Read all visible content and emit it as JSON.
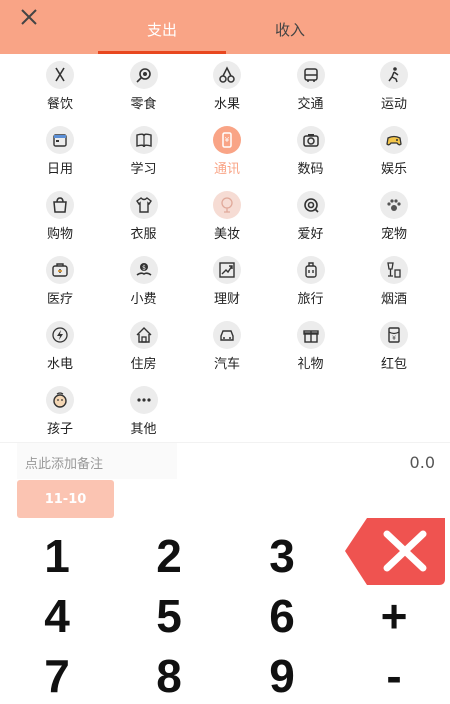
{
  "header": {
    "tabs": [
      {
        "label": "支出"
      },
      {
        "label": "收入"
      }
    ]
  },
  "categories": [
    {
      "label": "餐饮",
      "icon": "utensils-icon"
    },
    {
      "label": "零食",
      "icon": "lollipop-icon"
    },
    {
      "label": "水果",
      "icon": "cherry-icon"
    },
    {
      "label": "交通",
      "icon": "bus-icon"
    },
    {
      "label": "运动",
      "icon": "running-icon"
    },
    {
      "label": "日用",
      "icon": "calendar-icon"
    },
    {
      "label": "学习",
      "icon": "book-icon"
    },
    {
      "label": "通讯",
      "icon": "phone-icon",
      "selected": true
    },
    {
      "label": "数码",
      "icon": "camera-icon"
    },
    {
      "label": "娱乐",
      "icon": "gamepad-icon"
    },
    {
      "label": "购物",
      "icon": "shopping-bag-icon"
    },
    {
      "label": "衣服",
      "icon": "shirt-icon"
    },
    {
      "label": "美妆",
      "icon": "mirror-icon"
    },
    {
      "label": "爱好",
      "icon": "hobby-icon"
    },
    {
      "label": "宠物",
      "icon": "paw-icon"
    },
    {
      "label": "医疗",
      "icon": "medical-kit-icon"
    },
    {
      "label": "小费",
      "icon": "tip-hand-icon"
    },
    {
      "label": "理财",
      "icon": "chart-icon"
    },
    {
      "label": "旅行",
      "icon": "luggage-icon"
    },
    {
      "label": "烟酒",
      "icon": "wine-icon"
    },
    {
      "label": "水电",
      "icon": "bolt-icon"
    },
    {
      "label": "住房",
      "icon": "house-icon"
    },
    {
      "label": "汽车",
      "icon": "car-icon"
    },
    {
      "label": "礼物",
      "icon": "gift-icon"
    },
    {
      "label": "红包",
      "icon": "red-packet-icon"
    },
    {
      "label": "孩子",
      "icon": "baby-icon"
    },
    {
      "label": "其他",
      "icon": "more-icon"
    }
  ],
  "note": {
    "placeholder": "点此添加备注"
  },
  "amount": "0.0",
  "date": "11-10",
  "keypad": [
    "1",
    "2",
    "3",
    "4",
    "5",
    "6",
    "+",
    "7",
    "8",
    "9",
    "-"
  ],
  "colors": {
    "accent": "#f9a486",
    "tab_underline": "#e8471f",
    "delete": "#ef5350"
  }
}
